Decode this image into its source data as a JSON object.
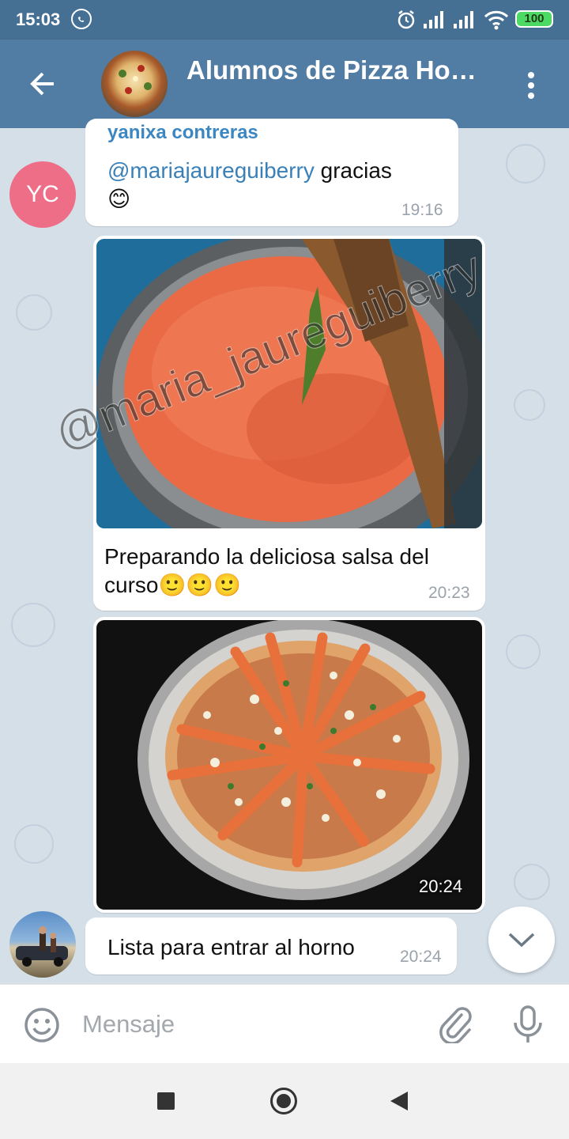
{
  "status_bar": {
    "time": "15:03",
    "battery": "100",
    "icons": [
      "whatsapp-icon",
      "alarm-icon",
      "signal-icon",
      "signal-icon",
      "wifi-icon",
      "battery-icon"
    ]
  },
  "header": {
    "title": "Alumnos de Pizza Ho…",
    "back_icon": "arrow-left-icon",
    "menu_icon": "more-vertical-icon",
    "colors": {
      "bar": "#517ca4",
      "status": "#466f94"
    }
  },
  "messages": [
    {
      "sender": "yanixa contreras",
      "avatar_initials": "YC",
      "avatar_color": "#ee6e87",
      "mention": "@mariajaureguiberry",
      "text": " gracias",
      "emoji": "😊",
      "time": "19:16"
    },
    {
      "type": "photo",
      "photo_subject": "tomato-sauce-pan",
      "caption_line1": "Preparando la deliciosa salsa del",
      "caption_line2": "curso🙂🙂🙂",
      "time": "20:23"
    },
    {
      "type": "photo",
      "photo_subject": "raw-pizza",
      "time": "20:24"
    },
    {
      "text": "Lista para entrar al horno",
      "time": "20:24"
    }
  ],
  "watermark": "@maria_jaureguiberry",
  "input": {
    "placeholder": "Mensaje",
    "value": ""
  }
}
